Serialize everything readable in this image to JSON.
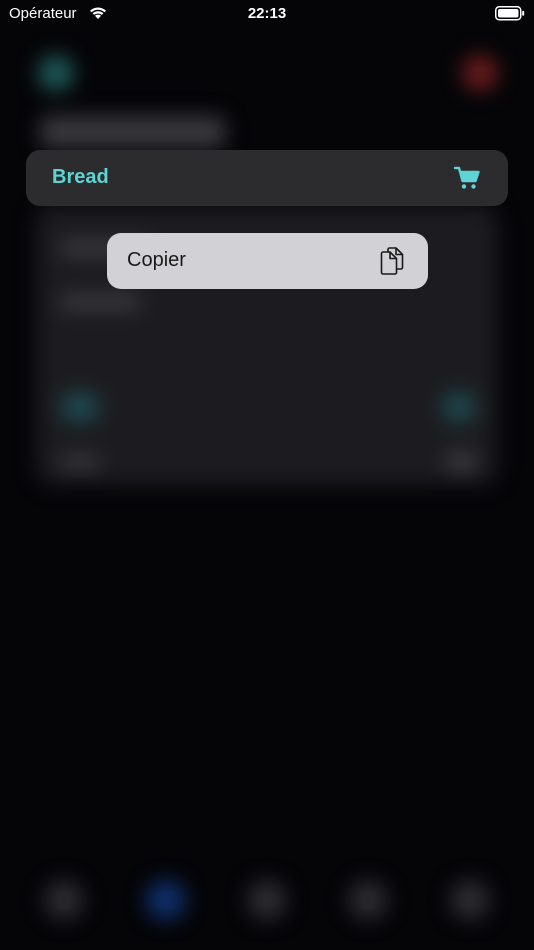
{
  "status_bar": {
    "carrier": "Opérateur",
    "time": "22:13"
  },
  "selected_item": {
    "label": "Bread",
    "accent_color": "#5fd4d4",
    "icon": "cart-icon"
  },
  "context_menu": {
    "items": [
      {
        "label": "Copier",
        "icon": "copy-icon"
      }
    ]
  }
}
